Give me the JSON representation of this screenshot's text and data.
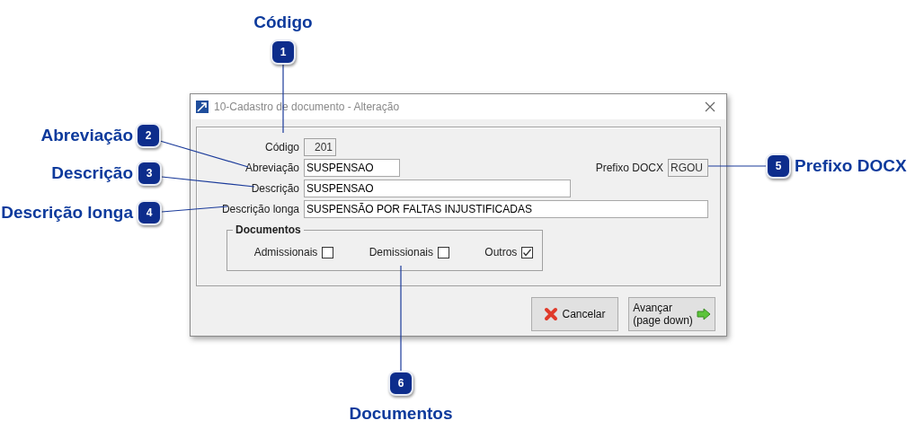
{
  "callouts": [
    {
      "number": "1",
      "label": "Código"
    },
    {
      "number": "2",
      "label": "Abreviação"
    },
    {
      "number": "3",
      "label": "Descrição"
    },
    {
      "number": "4",
      "label": "Descrição longa"
    },
    {
      "number": "5",
      "label": "Prefixo DOCX"
    },
    {
      "number": "6",
      "label": "Documentos"
    }
  ],
  "dialog": {
    "title": "10-Cadastro de documento - Alteração",
    "fields": [
      {
        "label": "Código",
        "value": "201",
        "disabled": true
      },
      {
        "label": "Abreviação",
        "value": "SUSPENSAO",
        "disabled": false
      },
      {
        "label": "Descrição",
        "value": "SUSPENSAO",
        "disabled": false
      },
      {
        "label": "Descrição longa",
        "value": "SUSPENSÃO POR FALTAS INJUSTIFICADAS",
        "disabled": false
      }
    ],
    "side_field": {
      "label": "Prefixo DOCX",
      "value": "RGOU",
      "disabled": true
    },
    "group": {
      "title": "Documentos",
      "checkboxes": [
        {
          "label": "Admissionais",
          "checked": false
        },
        {
          "label": "Demissionais",
          "checked": false
        },
        {
          "label": "Outros",
          "checked": true
        }
      ]
    },
    "buttons": [
      {
        "kind": "cancel",
        "lines": [
          "Cancelar"
        ]
      },
      {
        "kind": "next",
        "lines": [
          "Avançar",
          "(page down)"
        ]
      }
    ]
  }
}
